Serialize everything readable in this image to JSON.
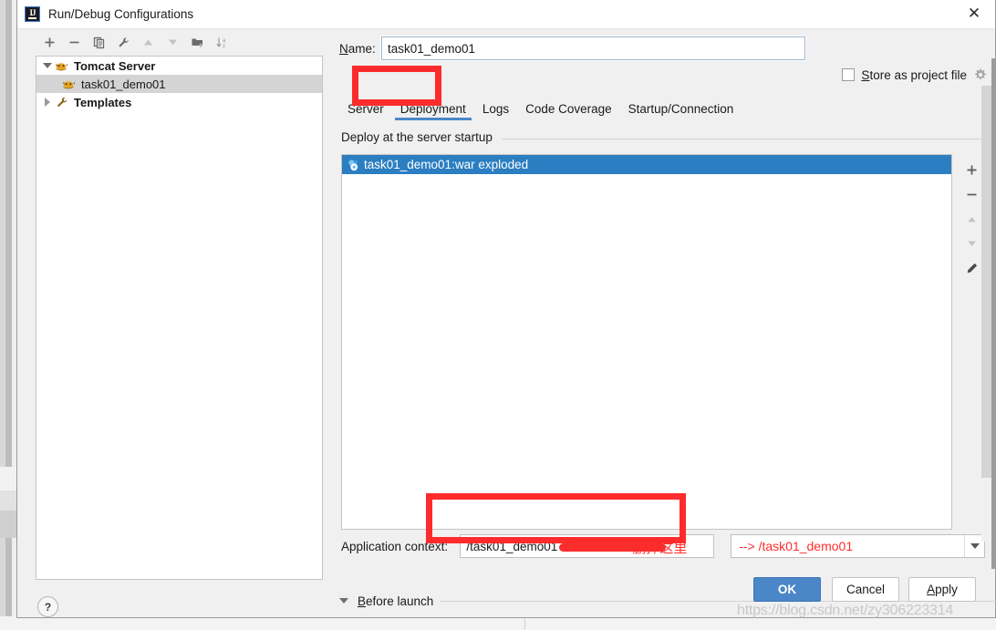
{
  "window": {
    "title": "Run/Debug Configurations",
    "app_icon": "intellij-idea-icon",
    "close_icon": "close-icon"
  },
  "sidebar": {
    "toolbar": [
      {
        "name": "add-configuration-button",
        "icon": "plus-icon"
      },
      {
        "name": "remove-configuration-button",
        "icon": "minus-icon"
      },
      {
        "name": "copy-configuration-button",
        "icon": "copy-icon"
      },
      {
        "name": "edit-templates-button",
        "icon": "wrench-icon"
      },
      {
        "name": "move-up-button",
        "icon": "arrow-up-icon"
      },
      {
        "name": "move-down-button",
        "icon": "arrow-down-icon"
      },
      {
        "name": "move-into-folder-button",
        "icon": "folder-add-icon"
      },
      {
        "name": "sort-configurations-button",
        "icon": "sort-az-icon"
      }
    ],
    "tree": [
      {
        "label": "Tomcat Server",
        "icon": "tomcat-icon",
        "expanded": true,
        "level": 0,
        "selected": false
      },
      {
        "label": "task01_demo01",
        "icon": "tomcat-icon",
        "level": 1,
        "selected": true
      },
      {
        "label": "Templates",
        "icon": "wrench-icon",
        "expanded": false,
        "level": 0,
        "selected": false
      }
    ],
    "help_label": "?"
  },
  "form": {
    "name_label": "Name:",
    "name_label_mnemonic": "N",
    "name_label_rest": "ame:",
    "name_value": "task01_demo01",
    "store_as_project_file_label": "Store as project file",
    "store_as_project_file_mnemonic": "S",
    "store_as_project_file_rest": "tore as project file",
    "store_checked": false,
    "settings_icon": "gear-icon"
  },
  "tabs": [
    {
      "label": "Server",
      "active": false
    },
    {
      "label": "Deployment",
      "active": true
    },
    {
      "label": "Logs",
      "active": false
    },
    {
      "label": "Code Coverage",
      "active": false
    },
    {
      "label": "Startup/Connection",
      "active": false
    }
  ],
  "deployment": {
    "group_title": "Deploy at the server startup",
    "artifacts": [
      {
        "label": "task01_demo01:war exploded",
        "icon": "artifact-icon",
        "selected": true
      }
    ],
    "side_tools": [
      {
        "name": "add-artifact-button",
        "icon": "plus-icon"
      },
      {
        "name": "remove-artifact-button",
        "icon": "minus-icon"
      },
      {
        "name": "move-artifact-up-button",
        "icon": "arrow-up-icon"
      },
      {
        "name": "move-artifact-down-button",
        "icon": "arrow-down-icon"
      },
      {
        "name": "edit-artifact-button",
        "icon": "pencil-icon"
      }
    ],
    "application_context_label": "Application context:",
    "application_context_value": "/task01_demo01_war_exploded",
    "application_context_visible_prefix": "/task01_demo01"
  },
  "annotations": {
    "delete_here_note": "删掉这里",
    "result_hint": "--> /task01_demo01",
    "highlight_color": "#fd2b2b"
  },
  "before_launch": {
    "label": "Before launch",
    "mnemonic": "B",
    "rest": "efore launch",
    "expanded": true
  },
  "buttons": {
    "ok": "OK",
    "cancel": "Cancel",
    "apply": "Apply",
    "apply_mnemonic": "A",
    "apply_rest": "pply"
  },
  "watermark": "https://blog.csdn.net/zy306223314"
}
